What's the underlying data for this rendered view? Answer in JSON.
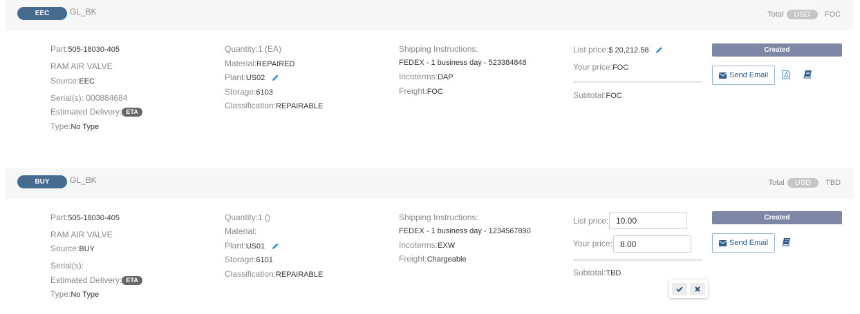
{
  "orders": [
    {
      "badge": "EEC",
      "code": "GL_BK",
      "total_label": "Total",
      "currency": "USD",
      "total_value": "FOC",
      "part_label": "Part:",
      "part_value": "505-18030-405",
      "description": "RAM AIR VALVE",
      "source_label": "Source:",
      "source_value": "EEC",
      "serial_label": "Serial(s): 000884684",
      "est_delivery_label": "Estimated Delivery:",
      "eta_badge": "ETA",
      "type_label": "Type:",
      "type_value": "No Type",
      "quantity_label": "Quantity:",
      "quantity_value": "1 (EA)",
      "material_label": "Material:",
      "material_value": "REPAIRED",
      "plant_label": "Plant:",
      "plant_value": "US02",
      "storage_label": "Storage:",
      "storage_value": "6103",
      "classification_label": "Classification:",
      "classification_value": "REPAIRABLE",
      "shipping_label": "Shipping Instructions:",
      "shipping_value": "FEDEX - 1 business day - 523384848",
      "incoterms_label": "Incoterms:",
      "incoterms_value": "DAP",
      "freight_label": "Freight:",
      "freight_value": "FOC",
      "list_price_label": "List price:",
      "list_price_value": "$ 20,212.58",
      "your_price_label": "Your price:",
      "your_price_value": "FOC",
      "subtotal_label": "Subtotal:",
      "subtotal_value": "FOC",
      "status": "Created",
      "send_email_label": "Send Email"
    },
    {
      "badge": "BUY",
      "code": "GL_BK",
      "total_label": "Total",
      "currency": "USD",
      "total_value": "TBD",
      "part_label": "Part:",
      "part_value": "505-18030-405",
      "description": "RAM AIR VALVE",
      "source_label": "Source:",
      "source_value": "BUY",
      "serial_label": "Serial(s):",
      "est_delivery_label": "Estimated Delivery:",
      "eta_badge": "ETA",
      "type_label": "Type:",
      "type_value": "No Type",
      "quantity_label": "Quantity:",
      "quantity_value": "1 ()",
      "material_label": "Material:",
      "material_value": "",
      "plant_label": "Plant:",
      "plant_value": "US01",
      "storage_label": "Storage:",
      "storage_value": "6101",
      "classification_label": "Classification:",
      "classification_value": "REPAIRABLE",
      "shipping_label": "Shipping Instructions:",
      "shipping_value": "FEDEX - 1 business day - 1234567890",
      "incoterms_label": "Incoterms:",
      "incoterms_value": "EXW",
      "freight_label": "Freight:",
      "freight_value": "Chargeable",
      "list_price_label": "List price:",
      "list_price_input": "10.00",
      "your_price_label": "Your price:",
      "your_price_input": "8.00",
      "subtotal_label": "Subtotal:",
      "subtotal_value": "TBD",
      "status": "Created",
      "send_email_label": "Send Email"
    }
  ],
  "colors": {
    "pill": "#456b8f",
    "status_bar": "#7e88a6",
    "link_blue": "#2d5e8e",
    "edit_icon": "#2a8bd8",
    "currency_badge": "#c6c6c6"
  },
  "icons": {
    "edit": "pencil-icon",
    "email": "envelope-icon",
    "pdf": "pdf-file-icon",
    "book": "book-icon",
    "confirm": "check-icon",
    "cancel": "close-icon"
  }
}
